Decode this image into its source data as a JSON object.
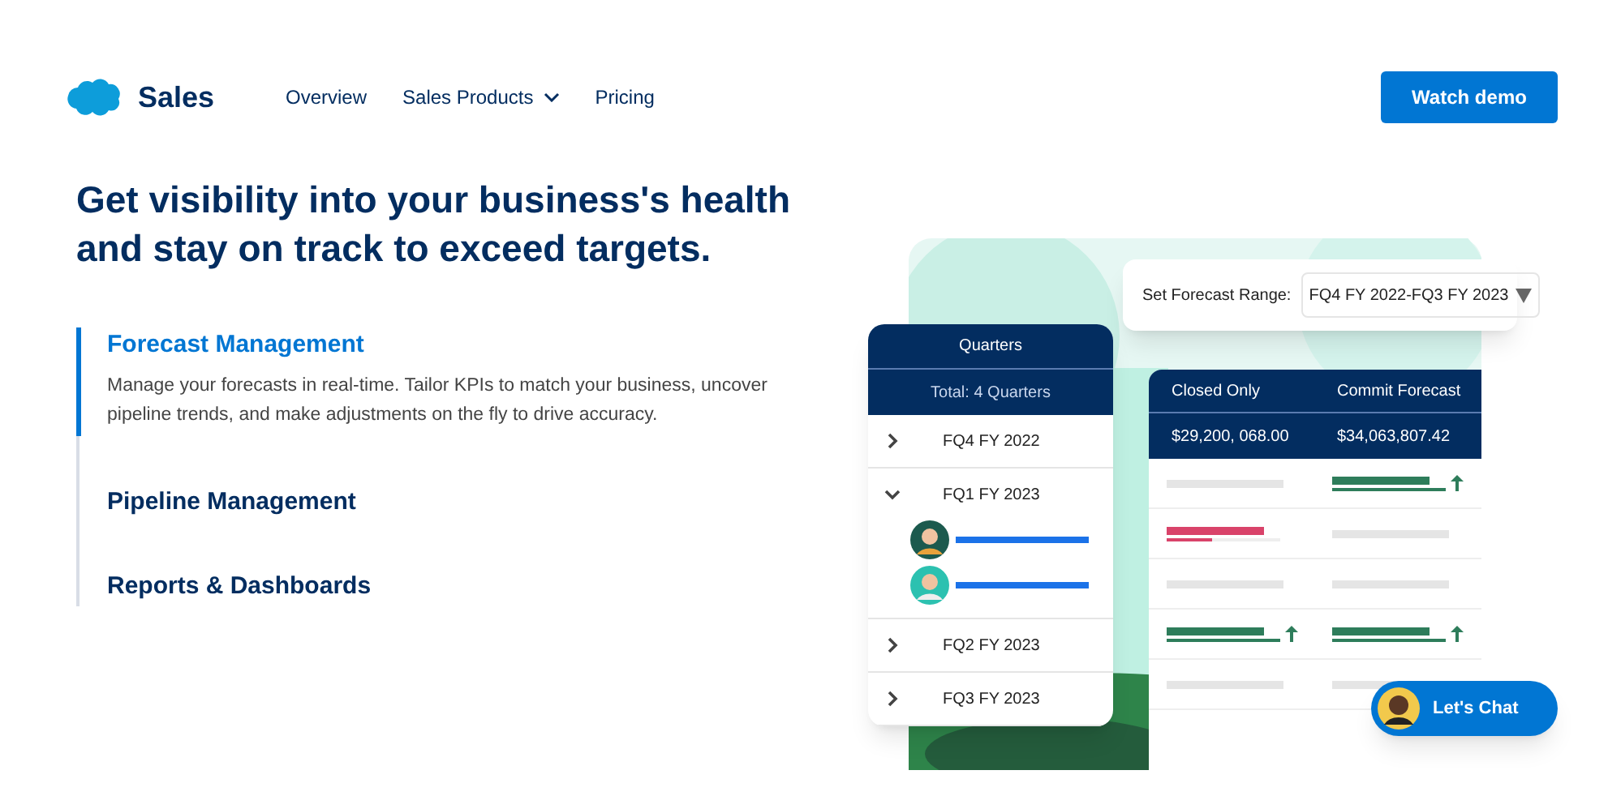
{
  "nav": {
    "brand": "Sales",
    "links": [
      {
        "label": "Overview",
        "dropdown": false
      },
      {
        "label": "Sales Products",
        "dropdown": true
      },
      {
        "label": "Pricing",
        "dropdown": false
      }
    ],
    "cta": "Watch demo"
  },
  "headline": "Get visibility into your business's health and stay on track to exceed targets.",
  "features": [
    {
      "title": "Forecast Management",
      "selected": true,
      "description": "Manage your forecasts in real-time. Tailor KPIs to match your business, uncover pipeline trends, and make adjustments on the fly to drive accuracy."
    },
    {
      "title": "Pipeline Management",
      "selected": false
    },
    {
      "title": "Reports & Dashboards",
      "selected": false
    }
  ],
  "illustration": {
    "range_label": "Set Forecast Range:",
    "range_value": "FQ4 FY 2022-FQ3 FY 2023",
    "quarters": {
      "title": "Quarters",
      "total": "Total: 4 Quarters",
      "rows": [
        {
          "label": "FQ4 FY 2022",
          "expanded": false
        },
        {
          "label": "FQ1 FY 2023",
          "expanded": true
        },
        {
          "label": "FQ2 FY 2023",
          "expanded": false
        },
        {
          "label": "FQ3 FY 2023",
          "expanded": false
        }
      ]
    },
    "table": {
      "columns": [
        "Closed Only",
        "Commit Forecast"
      ],
      "totals": [
        "$29,200, 068.00",
        "$34,063,807.42"
      ],
      "rows": [
        {
          "cells": [
            {
              "kind": "neutral"
            },
            {
              "kind": "up"
            }
          ]
        },
        {
          "cells": [
            {
              "kind": "down"
            },
            {
              "kind": "neutral"
            }
          ]
        },
        {
          "cells": [
            {
              "kind": "neutral"
            },
            {
              "kind": "neutral"
            }
          ]
        },
        {
          "cells": [
            {
              "kind": "up"
            },
            {
              "kind": "up"
            }
          ]
        },
        {
          "cells": [
            {
              "kind": "neutral"
            },
            {
              "kind": "neutral"
            }
          ]
        }
      ]
    }
  },
  "chat": {
    "label": "Let's Chat"
  }
}
